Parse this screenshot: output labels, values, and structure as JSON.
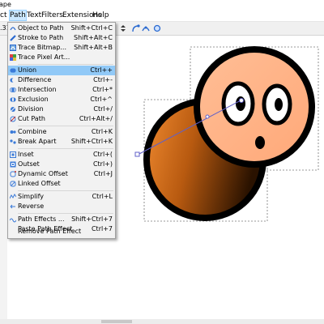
{
  "app": {
    "title_fragment": "ape"
  },
  "menubar": {
    "items": [
      {
        "label": "ct"
      },
      {
        "label": "Path"
      },
      {
        "label": "Text"
      },
      {
        "label": "Filters"
      },
      {
        "label": "Extensions"
      },
      {
        "label": "Help"
      }
    ]
  },
  "toolbar": {
    "x_value_fragment": ".31",
    "icons": [
      "spinner-arrows-icon",
      "align-icon",
      "node-icon",
      "node-smooth-icon",
      "snap-icon"
    ]
  },
  "path_menu": {
    "items": [
      {
        "label": "Object to Path",
        "shortcut": "Shift+Ctrl+C",
        "icon": "object-to-path-icon"
      },
      {
        "label": "Stroke to Path",
        "shortcut": "Shift+Alt+C",
        "icon": "stroke-to-path-icon"
      },
      {
        "label": "Trace Bitmap...",
        "shortcut": "Shift+Alt+B",
        "icon": "trace-bitmap-icon"
      },
      {
        "label": "Trace Pixel Art...",
        "shortcut": "",
        "icon": "trace-pixel-art-icon"
      },
      {
        "label": "Union",
        "shortcut": "Ctrl++",
        "icon": "union-icon",
        "highlighted": true
      },
      {
        "label": "Difference",
        "shortcut": "Ctrl+-",
        "icon": "difference-icon"
      },
      {
        "label": "Intersection",
        "shortcut": "Ctrl+*",
        "icon": "intersection-icon"
      },
      {
        "label": "Exclusion",
        "shortcut": "Ctrl+^",
        "icon": "exclusion-icon"
      },
      {
        "label": "Division",
        "shortcut": "Ctrl+/",
        "icon": "division-icon"
      },
      {
        "label": "Cut Path",
        "shortcut": "Ctrl+Alt+/",
        "icon": "cut-path-icon"
      },
      {
        "label": "Combine",
        "shortcut": "Ctrl+K",
        "icon": "combine-icon"
      },
      {
        "label": "Break Apart",
        "shortcut": "Shift+Ctrl+K",
        "icon": "break-apart-icon"
      },
      {
        "label": "Inset",
        "shortcut": "Ctrl+(",
        "icon": "inset-icon"
      },
      {
        "label": "Outset",
        "shortcut": "Ctrl+)",
        "icon": "outset-icon"
      },
      {
        "label": "Dynamic Offset",
        "shortcut": "Ctrl+J",
        "icon": "dynamic-offset-icon"
      },
      {
        "label": "Linked Offset",
        "shortcut": "",
        "icon": "linked-offset-icon"
      },
      {
        "label": "Simplify",
        "shortcut": "Ctrl+L",
        "icon": "simplify-icon"
      },
      {
        "label": "Reverse",
        "shortcut": "",
        "icon": "reverse-icon"
      },
      {
        "label": "Path Effects ...",
        "shortcut": "Shift+Ctrl+7",
        "icon": "path-effects-icon"
      },
      {
        "label": "Paste Path Effect",
        "shortcut": "Ctrl+7",
        "icon": ""
      },
      {
        "label": "Remove Path Effect",
        "shortcut": "",
        "icon": ""
      }
    ]
  },
  "colors": {
    "accent_highlight": "#91c9f7",
    "menu_bg": "#f2f2f2",
    "head_fill": "#ffb38a",
    "body_fill_dark": "#2a1200",
    "body_fill_mid": "#b85a10",
    "body_fill_light": "#f08a30",
    "outline": "#000000",
    "gradient_handle": "#6060c8"
  }
}
